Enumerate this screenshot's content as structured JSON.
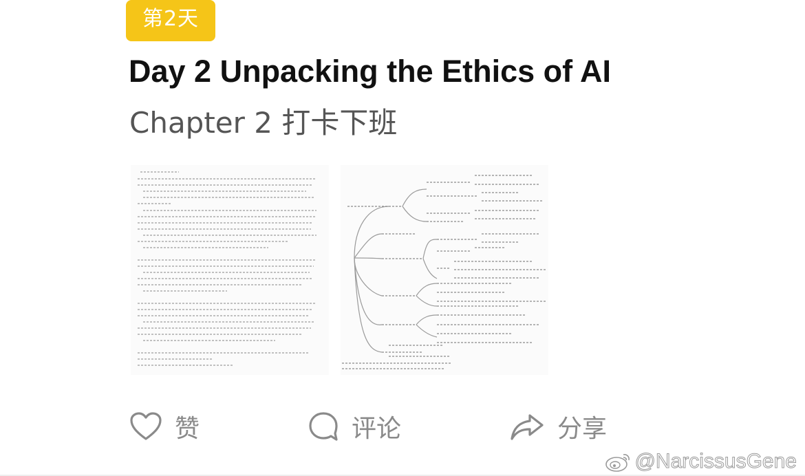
{
  "post": {
    "day_badge": "第2天",
    "title": "Day 2 Unpacking the Ethics of AI",
    "subtitle": "Chapter 2 打卡下班"
  },
  "images": [
    {
      "kind": "handwritten-notes-photo"
    },
    {
      "kind": "mind-map-photo"
    }
  ],
  "actions": {
    "like_label": "赞",
    "comment_label": "评论",
    "share_label": "分享",
    "like_icon": "heart-icon",
    "comment_icon": "comment-bubble-icon",
    "share_icon": "share-arrow-icon"
  },
  "watermark": {
    "text": "@NarcissusGene",
    "icon": "weibo-icon"
  }
}
